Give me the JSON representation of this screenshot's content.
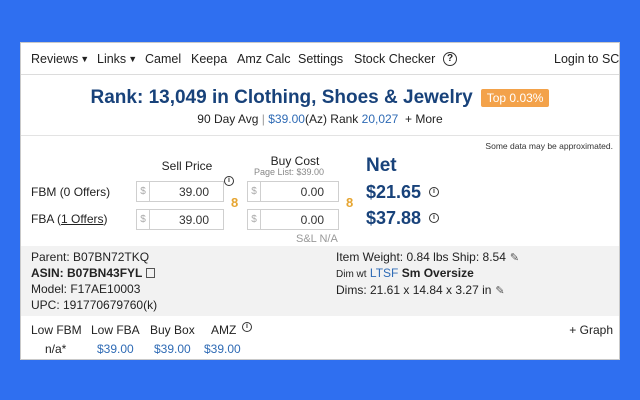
{
  "nav": {
    "items": [
      "Reviews",
      "Links",
      "Camel",
      "Keepa",
      "Amz Calc",
      "Settings",
      "Stock Checker"
    ],
    "help": "?",
    "login": "Login to SC"
  },
  "rank": {
    "text": "Rank:  13,049 in Clothing, Shoes & Jewelry",
    "badge": "Top 0.03%",
    "avg_label": "90 Day Avg",
    "avg_price": "$39.00",
    "avg_rank_label": "(Az) Rank",
    "avg_rank": "20,027",
    "more": "+ More"
  },
  "approx_note": "Some data may be approximated.",
  "pricing": {
    "sell_price_header": "Sell Price",
    "buy_cost_header": "Buy Cost",
    "page_list": "Page List: $39.00",
    "net_header": "Net",
    "currency": "$",
    "fbm": {
      "label": "FBM",
      "offers": "(0 Offers)",
      "sell": "39.00",
      "buy": "0.00",
      "net": "$21.65"
    },
    "fba": {
      "label": "FBA",
      "offers_open": "(",
      "offers": "1 Offers",
      "offers_close": ")",
      "sell": "39.00",
      "buy": "0.00",
      "net": "$37.88"
    },
    "sl": "S&L N/A",
    "info_glyph": "i",
    "link_glyph": "8"
  },
  "details": {
    "parent": "Parent: B07BN72TKQ",
    "asin": "ASIN: B07BN43FYL",
    "model": "Model: F17AE10003",
    "upc": "UPC: 191770679760(k)",
    "weight": "Item Weight: 0.84 lbs Ship: 8.54",
    "dim_wt_label": "Dim wt",
    "dim_wt_value": "LTSF",
    "size": "Sm Oversize",
    "dims": "Dims: 21.61 x 14.84 x 3.27 in",
    "pencil": "✎"
  },
  "bottom": {
    "headers": [
      "Low FBM",
      "Low FBA",
      "Buy Box",
      "AMZ"
    ],
    "values": [
      "n/a*",
      "$39.00",
      "$39.00",
      "$39.00"
    ],
    "graph": "+ Graph"
  },
  "colors": {
    "background": "#2f6ff0",
    "brand": "#18427a",
    "badge": "#f3a24a",
    "link": "#2f6bb5"
  }
}
